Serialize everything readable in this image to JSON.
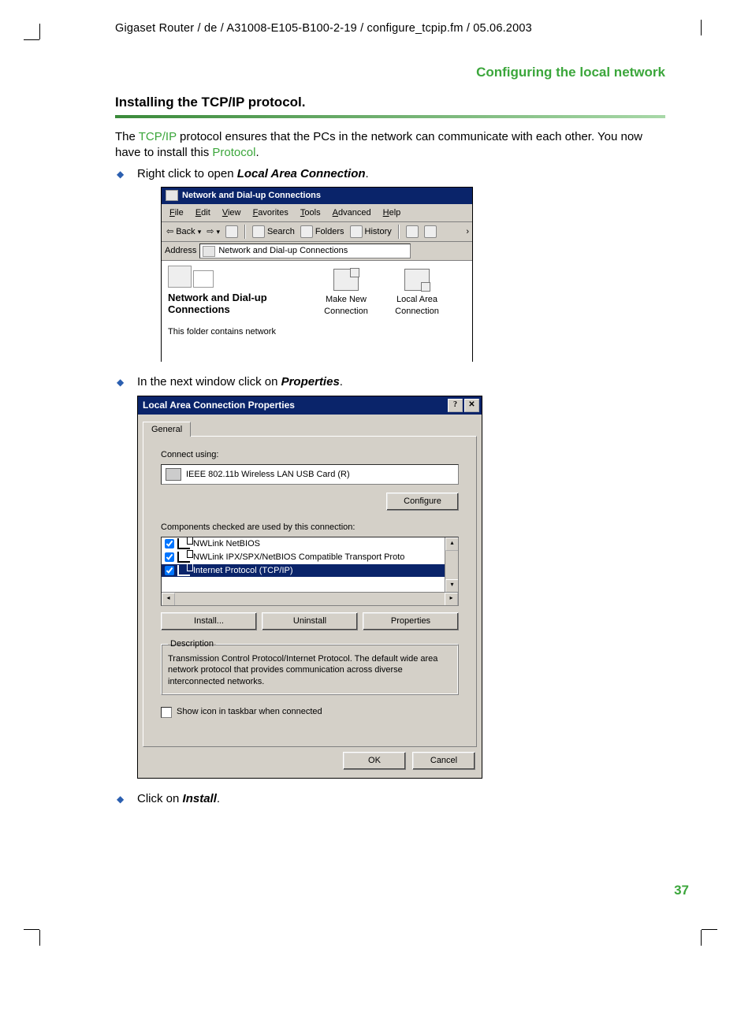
{
  "path_line": "Gigaset Router / de / A31008-E105-B100-2-19 / configure_tcpip.fm / 05.06.2003",
  "section_header": "Configuring the local network",
  "subtitle": "Installing the TCP/IP protocol.",
  "intro": {
    "pre": "The ",
    "link1": "TCP/IP",
    "mid": " protocol ensures that the PCs in the network can communicate with each other. You now have to install this ",
    "link2": "Protocol",
    "post": "."
  },
  "step1": {
    "pre": "Right click to open ",
    "bold": "Local Area Connection",
    "post": "."
  },
  "step2": {
    "pre": "In the next window click on ",
    "bold": "Properties",
    "post": "."
  },
  "step3": {
    "pre": "Click on ",
    "bold": "Install",
    "post": "."
  },
  "shot1": {
    "title": "Network and Dial-up Connections",
    "menu": {
      "file": "File",
      "edit": "Edit",
      "view": "View",
      "favorites": "Favorites",
      "tools": "Tools",
      "advanced": "Advanced",
      "help": "Help"
    },
    "toolbar": {
      "back": "Back",
      "search": "Search",
      "folders": "Folders",
      "history": "History"
    },
    "address_label": "Address",
    "address_value": "Network and Dial-up Connections",
    "left_title": "Network and Dial-up Connections",
    "left_desc": "This folder contains network",
    "item1_l1": "Make New",
    "item1_l2": "Connection",
    "item2_l1": "Local Area",
    "item2_l2": "Connection"
  },
  "shot2": {
    "title": "Local Area Connection Properties",
    "help_btn": "?",
    "close_btn": "✕",
    "tab": "General",
    "connect_using": "Connect using:",
    "nic": "IEEE 802.11b Wireless LAN USB Card (R)",
    "configure": "Configure",
    "components_label": "Components checked are used by this connection:",
    "comp1": "NWLink NetBIOS",
    "comp2": "NWLink IPX/SPX/NetBIOS Compatible Transport Proto",
    "comp3": "Internet Protocol (TCP/IP)",
    "install": "Install...",
    "uninstall": "Uninstall",
    "properties": "Properties",
    "desc_legend": "Description",
    "desc_text": "Transmission Control Protocol/Internet Protocol. The default wide area network protocol that provides communication across diverse interconnected networks.",
    "show_icon": "Show icon in taskbar when connected",
    "ok": "OK",
    "cancel": "Cancel"
  },
  "page_number": "37"
}
